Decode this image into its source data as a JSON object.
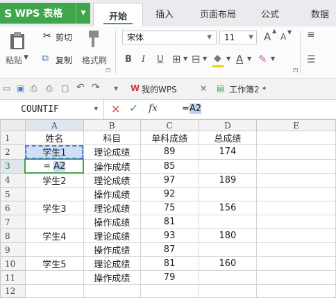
{
  "app": {
    "logo": "S",
    "name": "WPS 表格"
  },
  "menu": {
    "tabs": [
      "开始",
      "插入",
      "页面布局",
      "公式",
      "数据"
    ]
  },
  "ribbon": {
    "paste_label": "粘贴",
    "cut_label": "剪切",
    "copy_label": "复制",
    "format_painter_label": "格式刷",
    "font_name": "宋体",
    "font_size": "11",
    "bold": "B",
    "italic": "I",
    "underline": "U",
    "grow_font": "A",
    "shrink_font": "A"
  },
  "quickbar": {
    "doc_tabs": [
      "我的WPS",
      "工作簿2 *"
    ]
  },
  "formula_bar": {
    "name_box": "COUNTIF",
    "cancel": "×",
    "confirm": "✓",
    "fx": "fx",
    "prefix": "=",
    "ref": "A2"
  },
  "grid": {
    "col_headers": [
      "A",
      "B",
      "C",
      "D",
      "E"
    ],
    "rows": [
      {
        "num": "1",
        "cells": [
          "姓名",
          "科目",
          "单科成绩",
          "总成绩",
          ""
        ]
      },
      {
        "num": "2",
        "cells": [
          "学生1",
          "理论成绩",
          "89",
          "174",
          ""
        ]
      },
      {
        "num": "3",
        "cells": [
          "",
          "操作成绩",
          "85",
          "",
          ""
        ]
      },
      {
        "num": "4",
        "cells": [
          "学生2",
          "理论成绩",
          "97",
          "189",
          ""
        ]
      },
      {
        "num": "5",
        "cells": [
          "",
          "操作成绩",
          "92",
          "",
          ""
        ]
      },
      {
        "num": "6",
        "cells": [
          "学生3",
          "理论成绩",
          "75",
          "156",
          ""
        ]
      },
      {
        "num": "7",
        "cells": [
          "",
          "操作成绩",
          "81",
          "",
          ""
        ]
      },
      {
        "num": "8",
        "cells": [
          "学生4",
          "理论成绩",
          "93",
          "180",
          ""
        ]
      },
      {
        "num": "9",
        "cells": [
          "",
          "操作成绩",
          "87",
          "",
          ""
        ]
      },
      {
        "num": "10",
        "cells": [
          "学生5",
          "理论成绩",
          "81",
          "160",
          ""
        ]
      },
      {
        "num": "11",
        "cells": [
          "",
          "操作成绩",
          "79",
          "",
          ""
        ]
      },
      {
        "num": "12",
        "cells": [
          "",
          "",
          "",
          "",
          ""
        ]
      }
    ],
    "editing_cell": {
      "prefix": "=",
      "ref": "A2"
    }
  },
  "colors": {
    "brand": "#3fa64b",
    "selection": "#cfe0f6",
    "cancel": "#d23b3b"
  }
}
